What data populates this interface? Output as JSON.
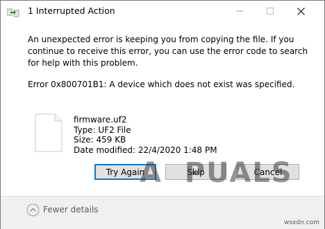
{
  "window": {
    "title": "1 Interrupted Action",
    "minimize_glyph": "—",
    "maximize_glyph": "☐",
    "close_glyph": "✕"
  },
  "message": {
    "body": "An unexpected error is keeping you from copying the file. If you continue to receive this error, you can use the error code to search for help with this problem.",
    "error": "Error 0x800701B1: A device which does not exist was specified."
  },
  "file": {
    "icon": "file-icon",
    "name": "firmware.uf2",
    "type": "Type: UF2 File",
    "size": "Size: 459 KB",
    "modified": "Date modified: 22/4/2020 1:48 PM"
  },
  "buttons": {
    "try_again": "Try Again",
    "skip": "Skip",
    "cancel": "Cancel"
  },
  "footer": {
    "toggle_label": "Fewer details",
    "toggle_icon": "chevron-up-icon"
  },
  "watermark": {
    "logo_text": "APPUALS",
    "site": "wsxdn.com"
  },
  "colors": {
    "accent": "#0078d7",
    "button_bg": "#e1e1e1",
    "footer_bg": "#f0f0f0"
  }
}
